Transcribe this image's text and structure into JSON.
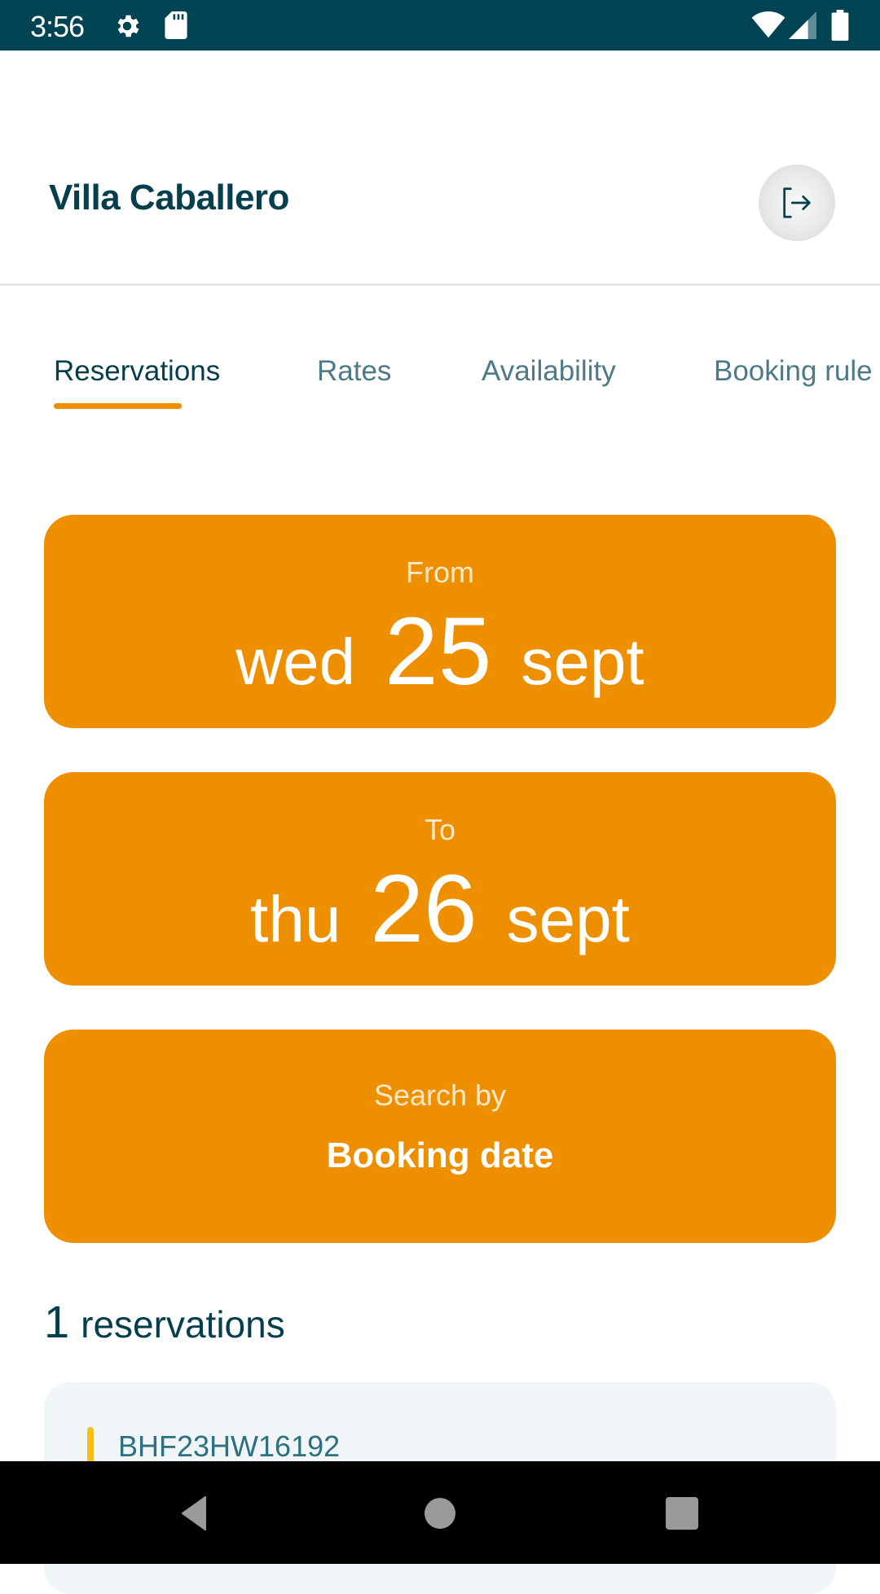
{
  "status_bar": {
    "time": "3:56",
    "icons": [
      "gear-icon",
      "sd-card-icon",
      "wifi-icon",
      "signal-icon",
      "battery-icon"
    ]
  },
  "header": {
    "title": "Villa Caballero",
    "logout_icon": "logout-icon"
  },
  "tabs": [
    {
      "label": "Reservations",
      "active": true
    },
    {
      "label": "Rates",
      "active": false
    },
    {
      "label": "Availability",
      "active": false
    },
    {
      "label": "Booking rule",
      "active": false
    }
  ],
  "filters": {
    "from": {
      "label": "From",
      "weekday": "wed",
      "day": "25",
      "month": "sept"
    },
    "to": {
      "label": "To",
      "weekday": "thu",
      "day": "26",
      "month": "sept"
    },
    "search_by": {
      "label": "Search by",
      "value": "Booking date"
    }
  },
  "results": {
    "count": "1",
    "label": "reservations",
    "items": [
      {
        "code": "BHF23HW16192",
        "status_color": "#f5c016"
      }
    ]
  },
  "colors": {
    "accent": "#ee8f00",
    "primary_text": "#053e4d",
    "status_bar": "#004353"
  },
  "nav_bar": {
    "buttons": [
      "back-icon",
      "home-icon",
      "recents-icon"
    ]
  }
}
